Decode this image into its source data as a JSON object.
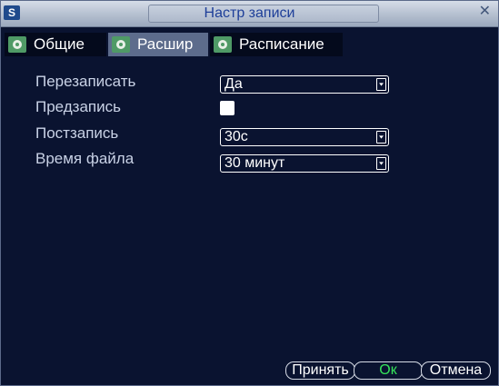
{
  "window": {
    "title": "Настр записи"
  },
  "tabs": [
    {
      "label": "Общие",
      "active": false
    },
    {
      "label": "Расшир",
      "active": true
    },
    {
      "label": "Расписание",
      "active": false
    }
  ],
  "settings": {
    "overwrite": {
      "label": "Перезаписать",
      "value": "Да"
    },
    "prerecord": {
      "label": "Предзапись",
      "checked": false
    },
    "postrecord": {
      "label": "Постзапись",
      "value": "30с"
    },
    "file_duration": {
      "label": "Время файла",
      "value": "30 минут"
    }
  },
  "buttons": {
    "apply": "Принять",
    "ok": "Ок",
    "cancel": "Отмена"
  },
  "colors": {
    "ok_text": "#36e35a",
    "title_text": "#1e3f99",
    "background": "#0a1330"
  }
}
